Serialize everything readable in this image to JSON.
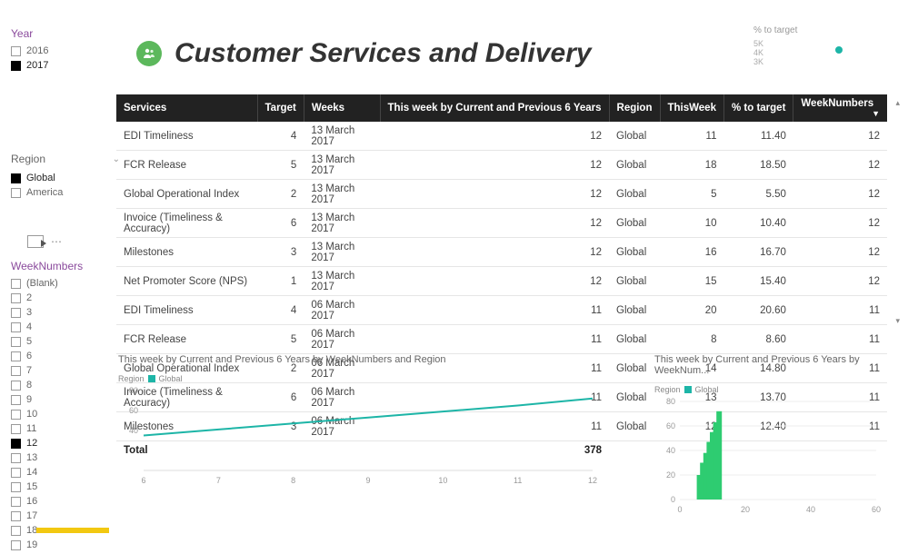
{
  "slicers": {
    "year": {
      "title": "Year",
      "items": [
        {
          "label": "2016",
          "checked": false
        },
        {
          "label": "2017",
          "checked": true
        }
      ]
    },
    "region": {
      "title": "Region",
      "items": [
        {
          "label": "Global",
          "checked": true
        },
        {
          "label": "America",
          "checked": false
        }
      ]
    },
    "weeknumbers": {
      "title": "WeekNumbers",
      "items": [
        {
          "label": "(Blank)",
          "checked": false
        },
        {
          "label": "2",
          "checked": false
        },
        {
          "label": "3",
          "checked": false
        },
        {
          "label": "4",
          "checked": false
        },
        {
          "label": "5",
          "checked": false
        },
        {
          "label": "6",
          "checked": false
        },
        {
          "label": "7",
          "checked": false
        },
        {
          "label": "8",
          "checked": false
        },
        {
          "label": "9",
          "checked": false
        },
        {
          "label": "10",
          "checked": false
        },
        {
          "label": "11",
          "checked": false
        },
        {
          "label": "12",
          "checked": true
        },
        {
          "label": "13",
          "checked": false
        },
        {
          "label": "14",
          "checked": false
        },
        {
          "label": "15",
          "checked": false
        },
        {
          "label": "16",
          "checked": false
        },
        {
          "label": "17",
          "checked": false
        },
        {
          "label": "18",
          "checked": false
        },
        {
          "label": "19",
          "checked": false
        }
      ]
    }
  },
  "header": {
    "title": "Customer Services and Delivery"
  },
  "kpi": {
    "label": "% to target",
    "ticks": [
      "5K",
      "4K",
      "3K"
    ]
  },
  "table": {
    "columns": [
      "Services",
      "Target",
      "Weeks",
      "This week by Current and Previous 6 Years",
      "Region",
      "ThisWeek",
      "% to target",
      "WeekNumbers"
    ],
    "rows": [
      {
        "service": "EDI Timeliness",
        "target": 4,
        "weeks": "13 March 2017",
        "prev6": 12,
        "region": "Global",
        "thisweek": 11,
        "pct": "11.40",
        "wn": 12
      },
      {
        "service": "FCR Release",
        "target": 5,
        "weeks": "13 March 2017",
        "prev6": 12,
        "region": "Global",
        "thisweek": 18,
        "pct": "18.50",
        "wn": 12
      },
      {
        "service": "Global Operational Index",
        "target": 2,
        "weeks": "13 March 2017",
        "prev6": 12,
        "region": "Global",
        "thisweek": 5,
        "pct": "5.50",
        "wn": 12
      },
      {
        "service": "Invoice (Timeliness & Accuracy)",
        "target": 6,
        "weeks": "13 March 2017",
        "prev6": 12,
        "region": "Global",
        "thisweek": 10,
        "pct": "10.40",
        "wn": 12
      },
      {
        "service": "Milestones",
        "target": 3,
        "weeks": "13 March 2017",
        "prev6": 12,
        "region": "Global",
        "thisweek": 16,
        "pct": "16.70",
        "wn": 12
      },
      {
        "service": "Net Promoter Score (NPS)",
        "target": 1,
        "weeks": "13 March 2017",
        "prev6": 12,
        "region": "Global",
        "thisweek": 15,
        "pct": "15.40",
        "wn": 12
      },
      {
        "service": "EDI Timeliness",
        "target": 4,
        "weeks": "06 March 2017",
        "prev6": 11,
        "region": "Global",
        "thisweek": 20,
        "pct": "20.60",
        "wn": 11
      },
      {
        "service": "FCR Release",
        "target": 5,
        "weeks": "06 March 2017",
        "prev6": 11,
        "region": "Global",
        "thisweek": 8,
        "pct": "8.60",
        "wn": 11
      },
      {
        "service": "Global Operational Index",
        "target": 2,
        "weeks": "06 March 2017",
        "prev6": 11,
        "region": "Global",
        "thisweek": 14,
        "pct": "14.80",
        "wn": 11
      },
      {
        "service": "Invoice (Timeliness & Accuracy)",
        "target": 6,
        "weeks": "06 March 2017",
        "prev6": 11,
        "region": "Global",
        "thisweek": 13,
        "pct": "13.70",
        "wn": 11
      },
      {
        "service": "Milestones",
        "target": 3,
        "weeks": "06 March 2017",
        "prev6": 11,
        "region": "Global",
        "thisweek": 12,
        "pct": "12.40",
        "wn": 11
      }
    ],
    "total_label": "Total",
    "total_prev6": 378
  },
  "chart_data": [
    {
      "type": "line",
      "title": "This week by Current and Previous 6 Years by WeekNumbers and Region",
      "legend_label": "Region",
      "series": [
        {
          "name": "Global",
          "values": [
            35,
            41,
            47,
            53,
            59,
            65,
            72
          ]
        }
      ],
      "x": [
        6,
        7,
        8,
        9,
        10,
        11,
        12
      ],
      "ylim": [
        0,
        80
      ],
      "yticks": [
        40,
        60,
        80
      ]
    },
    {
      "type": "bar",
      "title": "This week by Current and Previous 6 Years by WeekNum...",
      "legend_label": "Region",
      "series": [
        {
          "name": "Global",
          "values": [
            20,
            30,
            38,
            47,
            55,
            63,
            72
          ]
        }
      ],
      "x": [
        6,
        7,
        8,
        9,
        10,
        11,
        12
      ],
      "xlim": [
        0,
        60
      ],
      "ylim": [
        0,
        80
      ],
      "xticks": [
        0,
        20,
        40,
        60
      ],
      "yticks": [
        0,
        20,
        40,
        60,
        80
      ]
    }
  ]
}
